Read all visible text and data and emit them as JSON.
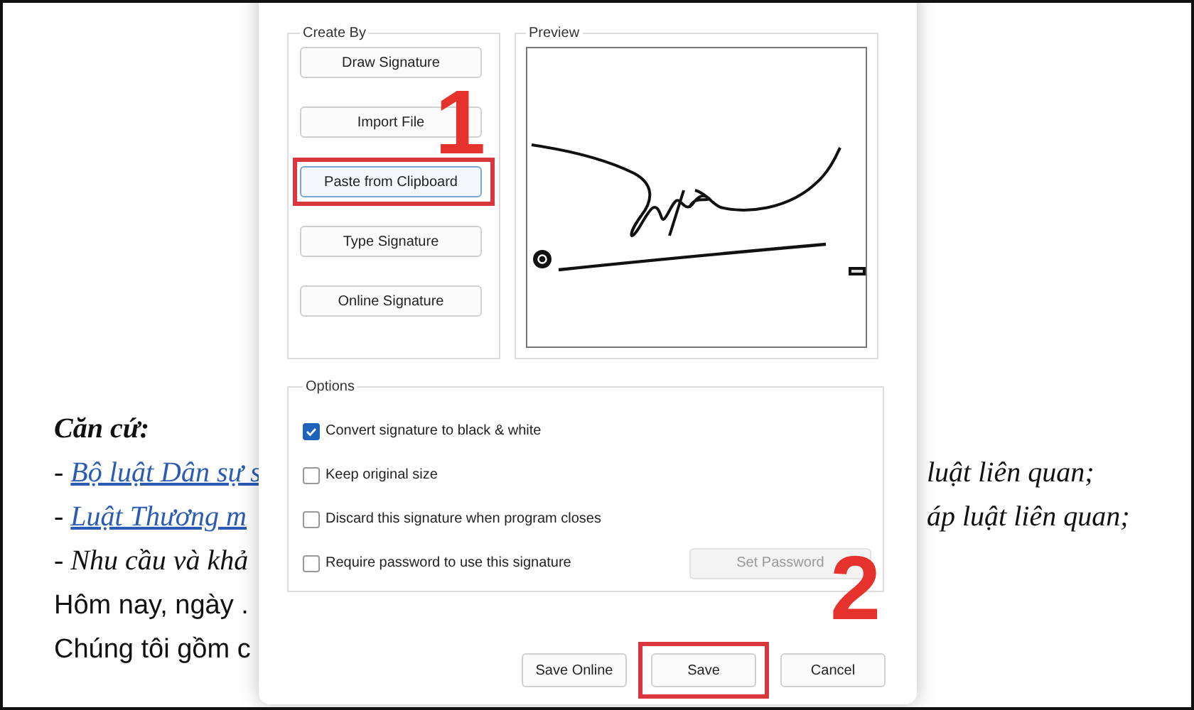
{
  "document": {
    "lines": [
      {
        "kind": "heading",
        "left": "Căn cứ:"
      },
      {
        "kind": "link",
        "prefix": "- ",
        "link": "Bộ luật Dân sự s",
        "right": "luật liên quan;"
      },
      {
        "kind": "link",
        "prefix": "- ",
        "link": "Luật Thương m",
        "right": "áp luật liên quan;"
      },
      {
        "kind": "italic",
        "left": "- Nhu cầu và khả"
      },
      {
        "kind": "plain",
        "left": "Hôm nay, ngày ."
      },
      {
        "kind": "plain",
        "left": "Chúng tôi gồm c"
      }
    ]
  },
  "dialog": {
    "create_by": {
      "title": "Create By",
      "buttons": [
        {
          "label": "Draw Signature",
          "focused": false,
          "highlighted": false
        },
        {
          "label": "Import File",
          "focused": false,
          "highlighted": false
        },
        {
          "label": "Paste from Clipboard",
          "focused": true,
          "highlighted": true
        },
        {
          "label": "Type Signature",
          "focused": false,
          "highlighted": false
        },
        {
          "label": "Online Signature",
          "focused": false,
          "highlighted": false
        }
      ]
    },
    "preview": {
      "title": "Preview"
    },
    "options": {
      "title": "Options",
      "items": [
        {
          "label": "Convert signature to black & white",
          "checked": true
        },
        {
          "label": "Keep original size",
          "checked": false
        },
        {
          "label": "Discard this signature when program closes",
          "checked": false
        },
        {
          "label": "Require password to use this signature",
          "checked": false
        }
      ],
      "set_password": {
        "label": "Set Password",
        "disabled": true
      }
    },
    "footer": [
      {
        "label": "Save Online",
        "highlighted": false
      },
      {
        "label": "Save",
        "highlighted": true
      },
      {
        "label": "Cancel",
        "highlighted": false
      }
    ]
  },
  "callouts": [
    "1",
    "2"
  ]
}
